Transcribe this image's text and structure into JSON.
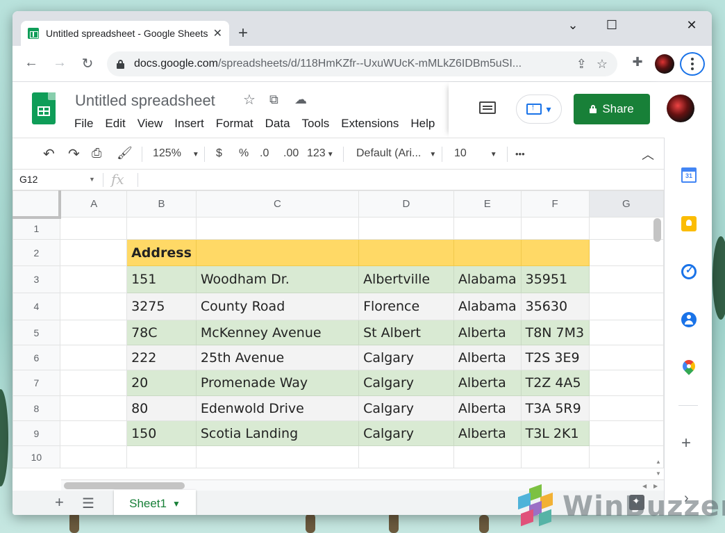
{
  "browser": {
    "tab_title": "Untitled spreadsheet - Google Sheets",
    "tab_close": "✕",
    "new_tab": "+",
    "window_controls": {
      "minimize": "⌄",
      "maximize": "☐",
      "close": "✕"
    },
    "nav": {
      "back": "←",
      "forward": "→",
      "reload": "↻"
    },
    "url_host": "docs.google.com",
    "url_rest": "/spreadsheets/d/118HmKZfr--UxuWUcK-mMLkZ6IDBm5uSI...",
    "icons": {
      "share": "share-icon",
      "bookmark": "star-icon",
      "extensions": "puzzle-icon",
      "menu": "kebab-menu-icon"
    }
  },
  "doc": {
    "title": "Untitled spreadsheet",
    "menu": [
      "File",
      "Edit",
      "View",
      "Insert",
      "Format",
      "Data",
      "Tools",
      "Extensions",
      "Help"
    ],
    "share_label": "Share"
  },
  "toolbar": {
    "zoom": "125%",
    "currency": "$",
    "percent": "%",
    "dec_decrease": ".0",
    "dec_increase": ".00",
    "number_format": "123",
    "font": "Default (Ari...",
    "font_size": "10",
    "more": "•••"
  },
  "formula_bar": {
    "name_box": "G12",
    "fx": "fx",
    "formula": ""
  },
  "grid": {
    "columns": [
      "A",
      "B",
      "C",
      "D",
      "E",
      "F",
      "G"
    ],
    "rows": [
      {
        "num": "1",
        "style": "plain",
        "cells": [
          "",
          "",
          "",
          "",
          "",
          "",
          ""
        ]
      },
      {
        "num": "2",
        "style": "header",
        "cells": [
          "",
          "Address",
          "",
          "",
          "",
          "",
          ""
        ]
      },
      {
        "num": "3",
        "style": "green",
        "cells": [
          "",
          "151",
          "Woodham Dr.",
          "Albertville",
          "Alabama",
          "35951",
          ""
        ]
      },
      {
        "num": "4",
        "style": "gray",
        "cells": [
          "",
          "3275",
          "County Road",
          "Florence",
          "Alabama",
          "35630",
          ""
        ]
      },
      {
        "num": "5",
        "style": "green",
        "cells": [
          "",
          "78C",
          "McKenney Avenue",
          "St Albert",
          "Alberta",
          "T8N 7M3",
          ""
        ]
      },
      {
        "num": "6",
        "style": "gray",
        "cells": [
          "",
          "222",
          "25th Avenue",
          "Calgary",
          "Alberta",
          "T2S 3E9",
          ""
        ]
      },
      {
        "num": "7",
        "style": "green",
        "cells": [
          "",
          "20",
          "Promenade Way",
          "Calgary",
          "Alberta",
          "T2Z 4A5",
          ""
        ]
      },
      {
        "num": "8",
        "style": "gray",
        "cells": [
          "",
          "80",
          "Edenwold Drive",
          "Calgary",
          "Alberta",
          "T3A 5R9",
          ""
        ]
      },
      {
        "num": "9",
        "style": "green",
        "cells": [
          "",
          "150",
          "Scotia Landing",
          "Calgary",
          "Alberta",
          "T3L 2K1",
          ""
        ]
      },
      {
        "num": "10",
        "style": "plain",
        "cells": [
          "",
          "",
          "",
          "",
          "",
          "",
          ""
        ]
      }
    ]
  },
  "sheets": {
    "add": "+",
    "all_sheets": "☰",
    "active_tab": "Sheet1"
  },
  "side_panel": {
    "calendar_day": "31",
    "add": "+",
    "expand": "›"
  },
  "colors": {
    "header_fill": "#ffd966",
    "green_fill": "#d9ead3",
    "gray_fill": "#f3f3f3",
    "share_green": "#188038",
    "accent_blue": "#1a73e8"
  },
  "watermark": "WinBuzzer"
}
